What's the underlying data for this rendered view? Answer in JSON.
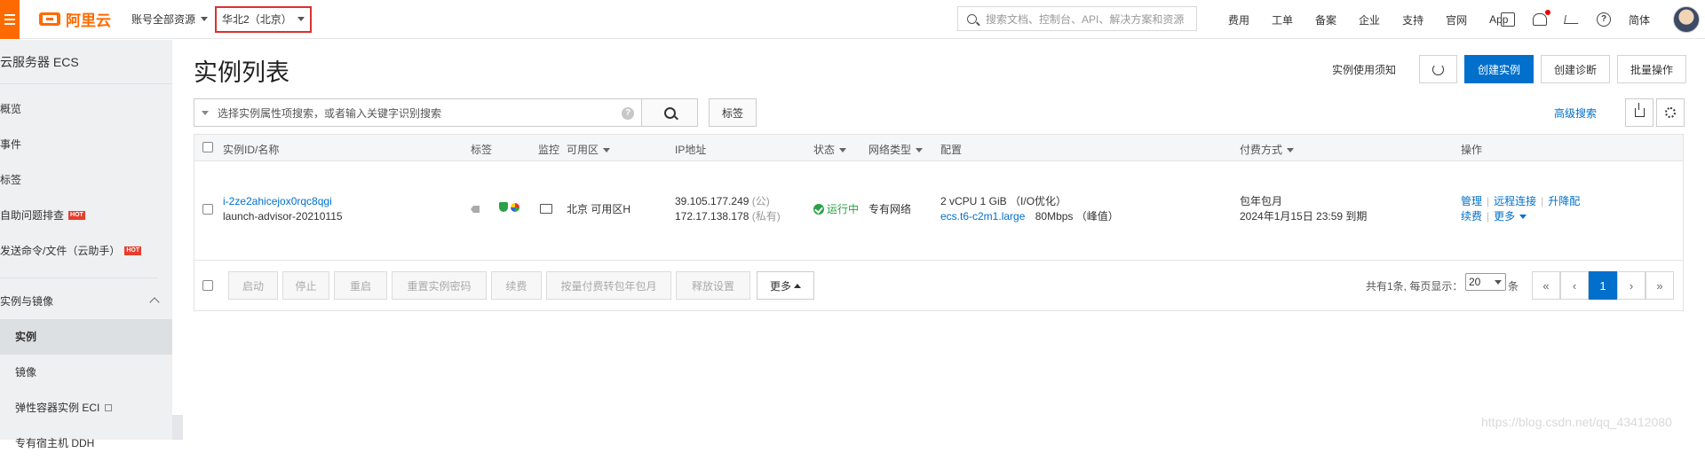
{
  "topbar": {
    "logo_text": "阿里云",
    "account_label": "账号全部资源",
    "region_label": "华北2（北京）",
    "search_placeholder": "搜索文档、控制台、API、解决方案和资源",
    "nav": [
      "费用",
      "工单",
      "备案",
      "企业",
      "支持",
      "官网",
      "App"
    ],
    "language": "简体",
    "icons": [
      "console-icon",
      "bell-icon",
      "cart-icon",
      "help-icon"
    ]
  },
  "sidebar": {
    "title": "云服务器 ECS",
    "items": [
      {
        "label": "概览",
        "hot": false
      },
      {
        "label": "事件",
        "hot": false
      },
      {
        "label": "标签",
        "hot": false
      },
      {
        "label": "自助问题排查",
        "hot": true
      },
      {
        "label": "发送命令/文件（云助手）",
        "hot": true
      }
    ],
    "hot_badge": "HOT",
    "group": {
      "label": "实例与镜像",
      "items": [
        {
          "label": "实例",
          "active": true
        },
        {
          "label": "镜像",
          "active": false
        },
        {
          "label": "弹性容器实例 ECI",
          "active": false
        },
        {
          "label": "专有宿主机 DDH",
          "active": false
        }
      ]
    }
  },
  "page": {
    "title": "实例列表",
    "notice_link": "实例使用须知",
    "create_button": "创建实例",
    "diagnose_button": "创建诊断",
    "batch_button": "批量操作"
  },
  "filter": {
    "placeholder": "选择实例属性项搜索，或者输入关键字识别搜索",
    "help": "?",
    "tag_button": "标签",
    "advanced_search": "高级搜索"
  },
  "table": {
    "columns": {
      "id_name": "实例ID/名称",
      "tags": "标签",
      "monitor": "监控",
      "zone": "可用区",
      "ip": "IP地址",
      "status": "状态",
      "network": "网络类型",
      "config": "配置",
      "billing": "付费方式",
      "actions": "操作"
    },
    "rows": [
      {
        "id": "i-2ze2ahicejox0rqc8qgi",
        "name": "launch-advisor-20210115",
        "zone": "北京 可用区H",
        "public_ip": "39.105.177.249",
        "public_suffix": "(公)",
        "private_ip": "172.17.138.178",
        "private_suffix": "(私有)",
        "status": "运行中",
        "network": "专有网络",
        "config_line1": "2 vCPU 1 GiB （I/O优化）",
        "instance_type": "ecs.t6-c2m1.large",
        "bandwidth": "80Mbps （峰值）",
        "billing_type": "包年包月",
        "expire": "2024年1月15日 23:59 到期",
        "actions": {
          "manage": "管理",
          "remote": "远程连接",
          "upgrade": "升降配",
          "renew": "续费",
          "more": "更多"
        }
      }
    ]
  },
  "footer": {
    "buttons": [
      "启动",
      "停止",
      "重启",
      "重置实例密码",
      "续费",
      "按量付费转包年包月",
      "释放设置"
    ],
    "more": "更多",
    "total_text": "共有1条, 每页显示：",
    "page_size": "20",
    "unit": "条",
    "pager": [
      "«",
      "‹",
      "1",
      "›",
      "»"
    ],
    "current_page": "1"
  },
  "watermark": "https://blog.csdn.net/qq_43412080"
}
